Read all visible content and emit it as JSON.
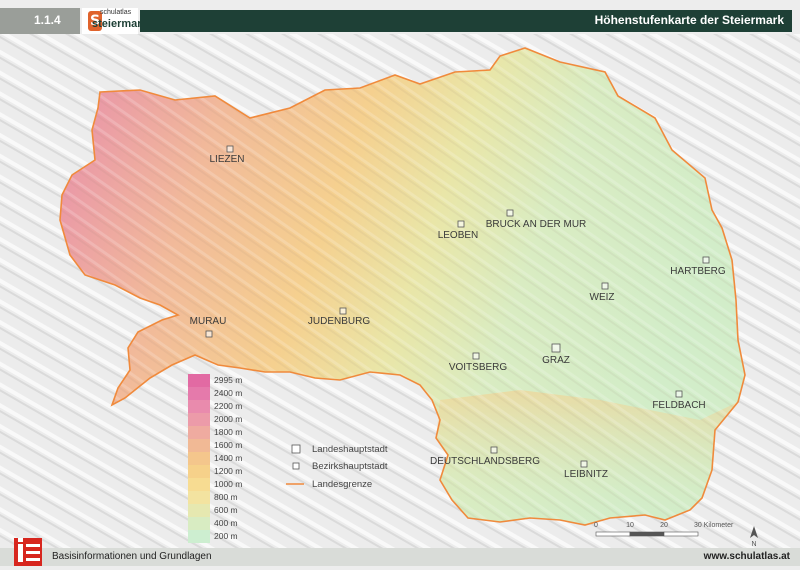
{
  "header": {
    "chapter_number": "1.1.4",
    "logo_small": "schulatlas",
    "logo_main": "steiermark",
    "title": "Höhenstufenkarte der Steiermark"
  },
  "cities": [
    {
      "name": "LIEZEN",
      "type": "bezirk"
    },
    {
      "name": "LEOBEN",
      "type": "bezirk"
    },
    {
      "name": "BRUCK AN DER MUR",
      "type": "bezirk"
    },
    {
      "name": "HARTBERG",
      "type": "bezirk"
    },
    {
      "name": "WEIZ",
      "type": "bezirk"
    },
    {
      "name": "MURAU",
      "type": "bezirk"
    },
    {
      "name": "JUDENBURG",
      "type": "bezirk"
    },
    {
      "name": "VOITSBERG",
      "type": "bezirk"
    },
    {
      "name": "GRAZ",
      "type": "landeshauptstadt"
    },
    {
      "name": "FELDBACH",
      "type": "bezirk"
    },
    {
      "name": "DEUTSCHLANDSBERG",
      "type": "bezirk"
    },
    {
      "name": "LEIBNITZ",
      "type": "bezirk"
    }
  ],
  "legend": {
    "elevation_steps": [
      {
        "label": "2995 m",
        "color": "#e26aa3"
      },
      {
        "label": "2400 m",
        "color": "#e57aab"
      },
      {
        "label": "2200 m",
        "color": "#e98bad"
      },
      {
        "label": "2000 m",
        "color": "#ec9ba9"
      },
      {
        "label": "1800 m",
        "color": "#efaba0"
      },
      {
        "label": "1600 m",
        "color": "#f1b995"
      },
      {
        "label": "1400 m",
        "color": "#f4c68c"
      },
      {
        "label": "1200 m",
        "color": "#f6d18a"
      },
      {
        "label": "1000 m",
        "color": "#f7dc92"
      },
      {
        "label": "800 m",
        "color": "#f3e3a0"
      },
      {
        "label": "600 m",
        "color": "#e6e8b0"
      },
      {
        "label": "400 m",
        "color": "#d8ecc2"
      },
      {
        "label": "200 m",
        "color": "#cdeed0"
      }
    ],
    "symbols": {
      "landeshauptstadt": "Landeshauptstadt",
      "bezirkshauptstadt": "Bezirkshauptstadt",
      "landesgrenze": "Landesgrenze"
    }
  },
  "scale": {
    "ticks": [
      "0",
      "10",
      "20",
      "30 Kilometer"
    ],
    "north": "N"
  },
  "colors": {
    "border": "#f08a3c",
    "header_bar": "#1e4036",
    "lowland": "#d8ecc2",
    "highland": "#e57aab"
  },
  "footer": {
    "left": "Basisinformationen und Grundlagen",
    "right": "www.schulatlas.at"
  }
}
